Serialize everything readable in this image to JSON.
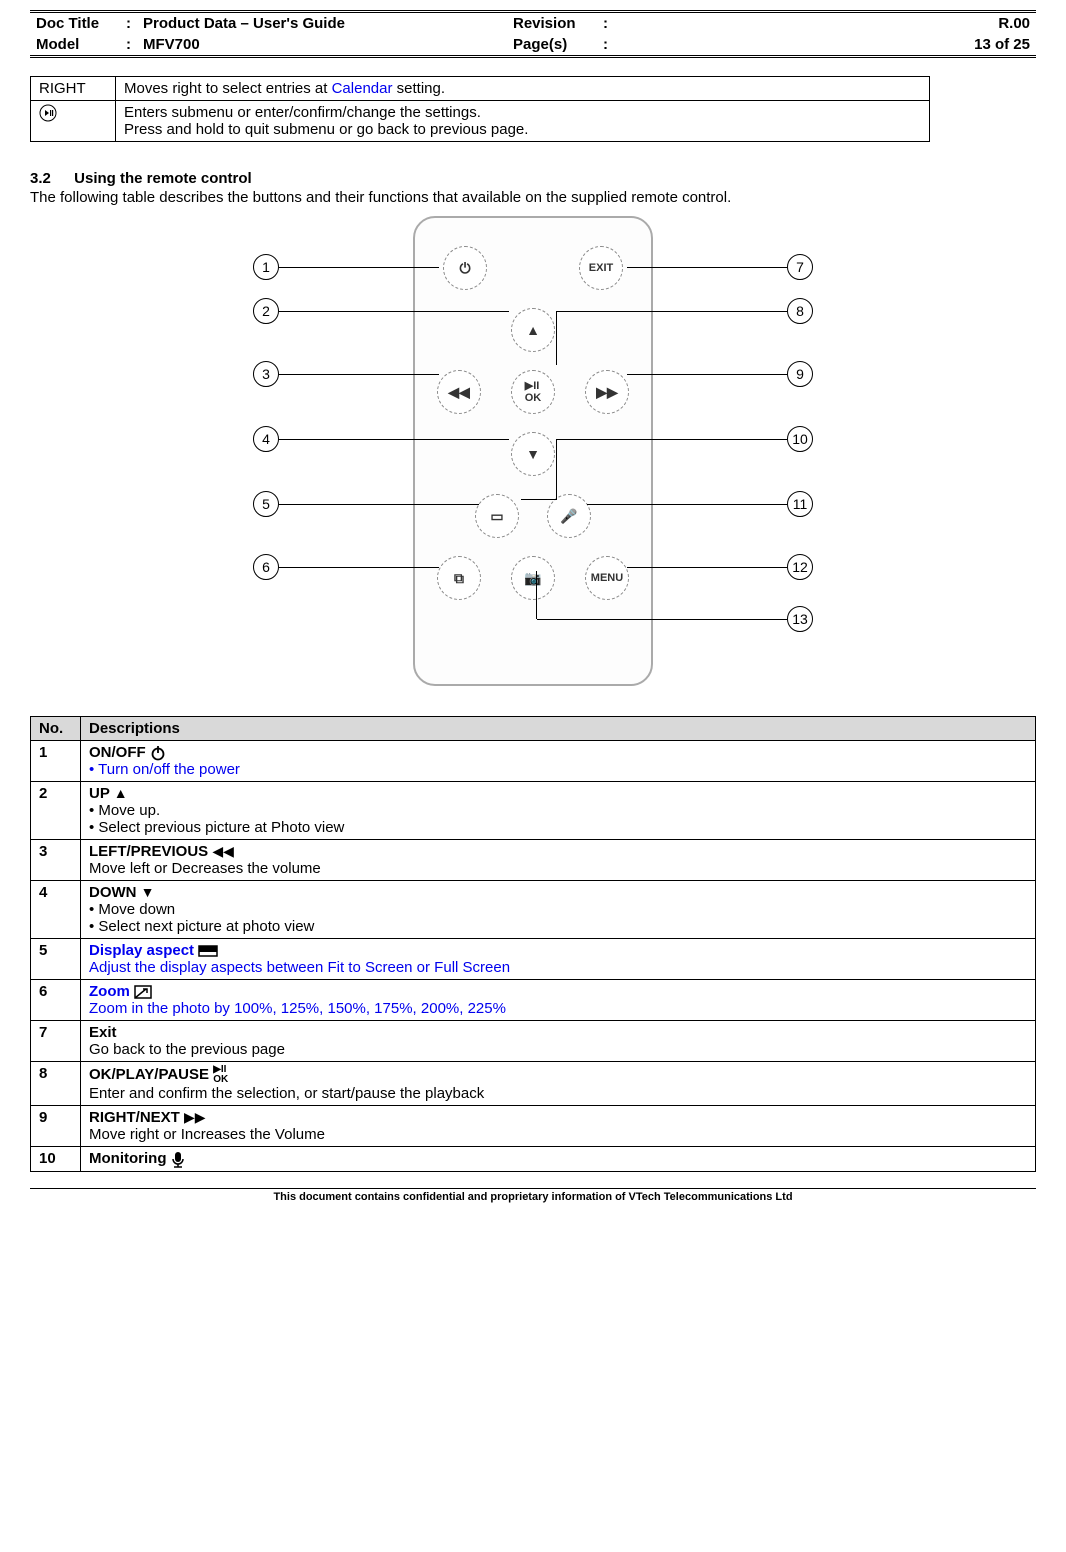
{
  "header": {
    "doc_title_label": "Doc Title",
    "doc_title": "Product Data – User's Guide",
    "model_label": "Model",
    "model": "MFV700",
    "revision_label": "Revision",
    "revision": "R.00",
    "pages_label": "Page(s)",
    "pages": "13 of 25",
    "colon": ":"
  },
  "info_rows": [
    {
      "label": "RIGHT",
      "icon": "",
      "text_pre": "Moves right to select entries at ",
      "text_link": "Calendar",
      "text_post": " setting."
    },
    {
      "label": "",
      "icon": "play-pause-circle-icon",
      "line1": "Enters submenu or enter/confirm/change the settings.",
      "line2": "Press and hold to quit submenu or go back to previous page."
    }
  ],
  "section": {
    "num": "3.2",
    "title": "Using the remote control",
    "intro": "The following table describes the buttons and their functions that available on the supplied remote control."
  },
  "remote_labels": {
    "n1": "1",
    "n2": "2",
    "n3": "3",
    "n4": "4",
    "n5": "5",
    "n6": "6",
    "n7": "7",
    "n8": "8",
    "n9": "9",
    "n10": "10",
    "n11": "11",
    "n12": "12",
    "n13": "13"
  },
  "remote_buttons": {
    "power": "⏻",
    "exit": "EXIT",
    "up": "▲",
    "left": "◀◀",
    "ok": "▶II\nOK",
    "right": "▶▶",
    "down": "▼",
    "aspect": "⛶",
    "mic": "🎤",
    "zoom": "⧉",
    "camera": "📷",
    "menu": "MENU"
  },
  "desc": {
    "header_no": "No.",
    "header_desc": "Descriptions",
    "rows": [
      {
        "no": "1",
        "title": "ON/OFF ",
        "icon": "power-icon",
        "bullets_blue": [
          "Turn on/off the power"
        ]
      },
      {
        "no": "2",
        "title": "UP ",
        "icon": "up-icon",
        "bullets": [
          "Move up.",
          "Select previous picture at Photo view"
        ]
      },
      {
        "no": "3",
        "title": "LEFT/PREVIOUS ",
        "icon": "rewind-icon",
        "line": "Move left or Decreases the volume"
      },
      {
        "no": "4",
        "title": "DOWN ",
        "icon": "down-icon",
        "bullets": [
          "Move down",
          "Select next picture at photo view"
        ]
      },
      {
        "no": "5",
        "title_blue": "Display aspect ",
        "icon": "aspect-icon",
        "line_blue": "Adjust the display aspects between Fit to Screen or Full Screen"
      },
      {
        "no": "6",
        "title_blue": "Zoom ",
        "icon": "zoom-icon",
        "line_blue": "Zoom in the photo by 100%, 125%, 150%, 175%, 200%, 225%"
      },
      {
        "no": "7",
        "title": "Exit",
        "line": "Go back to the previous page"
      },
      {
        "no": "8",
        "title": "OK/PLAY/PAUSE ",
        "icon": "ok-icon",
        "line": "Enter and confirm the selection, or start/pause the playback"
      },
      {
        "no": "9",
        "title": "RIGHT/NEXT ",
        "icon": "ff-icon",
        "line": "Move right or Increases the Volume"
      },
      {
        "no": "10",
        "title": "Monitoring ",
        "icon": "monitoring-icon"
      }
    ]
  },
  "footer": "This document contains confidential and proprietary information of VTech Telecommunications Ltd"
}
